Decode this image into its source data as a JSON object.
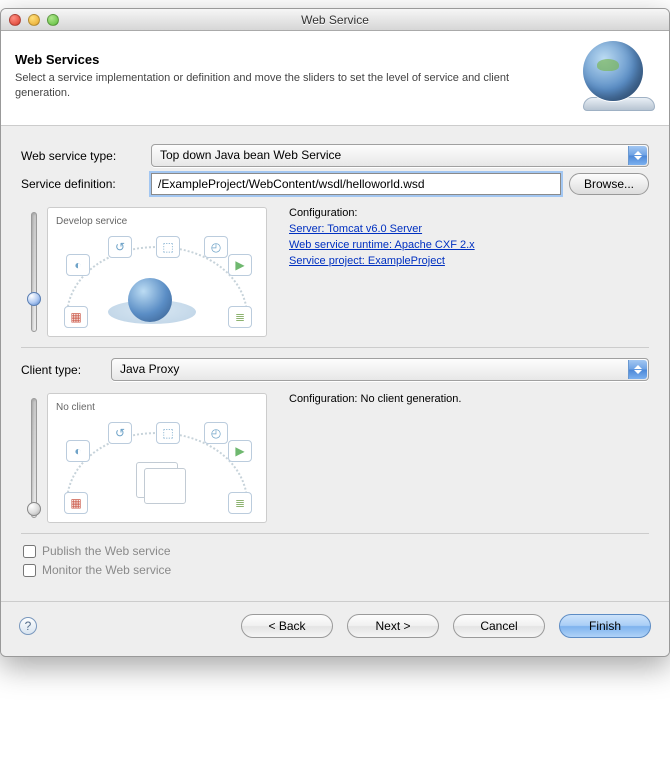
{
  "window": {
    "title": "Web Service"
  },
  "banner": {
    "heading": "Web Services",
    "subtext": "Select a service implementation or definition and move the sliders to set the level of service and client generation."
  },
  "fields": {
    "web_service_type": {
      "label": "Web service type:",
      "value": "Top down Java bean Web Service"
    },
    "service_definition": {
      "label": "Service definition:",
      "value": "/ExampleProject/WebContent/wsdl/helloworld.wsd",
      "browse": "Browse..."
    },
    "client_type": {
      "label": "Client type:",
      "value": "Java Proxy"
    }
  },
  "service": {
    "caption": "Develop service",
    "config_label": "Configuration:",
    "links": {
      "server": "Server: Tomcat v6.0 Server",
      "runtime": "Web service runtime: Apache CXF 2.x",
      "project": "Service project: ExampleProject"
    }
  },
  "client": {
    "caption": "No client",
    "config_text": "Configuration: No client generation."
  },
  "checks": {
    "publish": "Publish the Web service",
    "monitor": "Monitor the Web service"
  },
  "buttons": {
    "back": "< Back",
    "next": "Next >",
    "cancel": "Cancel",
    "finish": "Finish"
  }
}
